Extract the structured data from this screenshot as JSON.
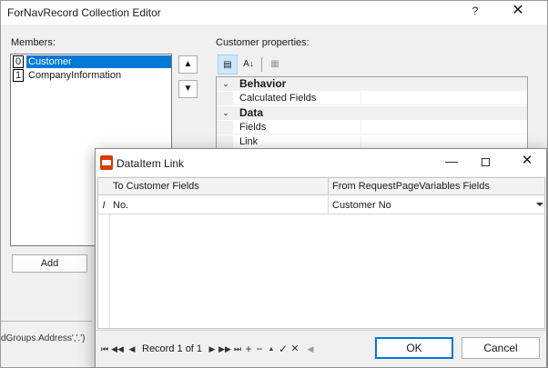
{
  "editor": {
    "title": "ForNavRecord Collection Editor",
    "help_glyph": "?",
    "close_glyph": "✕",
    "members_label": "Members:",
    "members": [
      {
        "index": "0",
        "name": "Customer"
      },
      {
        "index": "1",
        "name": "CompanyInformation"
      }
    ],
    "move_up_glyph": "▲",
    "move_down_glyph": "▼",
    "add_label": "Add",
    "code_snippet": "dGroups.Address','.')",
    "props_label": "Customer properties:",
    "toolbar": {
      "categorized_glyph": "▤",
      "alphabetical_glyph": "A↓",
      "pages_glyph": "▦"
    },
    "property_grid": [
      {
        "kind": "category",
        "name": "Behavior",
        "toggle": "⌄"
      },
      {
        "kind": "property",
        "name": "Calculated Fields"
      },
      {
        "kind": "category",
        "name": "Data",
        "toggle": "⌄"
      },
      {
        "kind": "property",
        "name": "Fields"
      },
      {
        "kind": "property",
        "name": "Link"
      }
    ]
  },
  "link_dialog": {
    "title": "DataItem Link",
    "minimize_glyph": "—",
    "close_glyph": "✕",
    "columns": [
      "To Customer Fields",
      "From RequestPageVariables Fields"
    ],
    "rows": [
      {
        "indicator": "I",
        "to": "No.",
        "from": "Customer No"
      }
    ],
    "navigator": {
      "first": "⏮",
      "prev_page": "◀◀",
      "prev": "◀",
      "record_text": "Record 1 of 1",
      "next": "▶",
      "next_page": "▶▶",
      "last": "⏭",
      "add": "+",
      "remove": "−",
      "up": "▲",
      "confirm": "✓",
      "cancel": "✕",
      "scroll": "◀"
    },
    "ok_label": "OK",
    "cancel_label": "Cancel"
  },
  "colors": {
    "selection": "#0078d7",
    "toolbar_active": "#cce8ff",
    "app_icon": "#d83b01"
  }
}
